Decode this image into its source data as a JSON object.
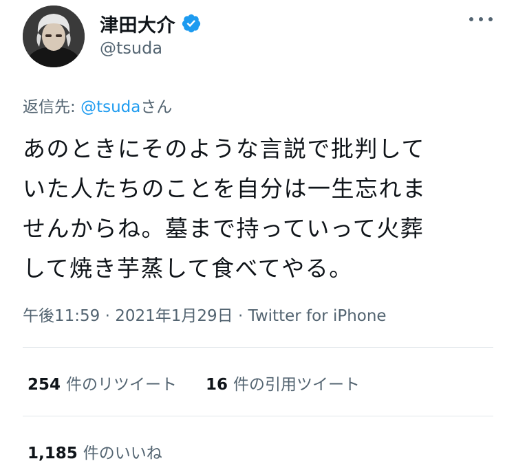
{
  "user": {
    "display_name": "津田大介",
    "handle": "@tsuda",
    "verified": true
  },
  "reply": {
    "prefix": "返信先: ",
    "mention": "@tsuda",
    "suffix": "さん"
  },
  "tweet": {
    "lines": [
      "あのときにそのような言説で批判して",
      "いた人たちのことを自分は一生忘れま",
      "せんからね。墓まで持っていって火葬",
      "して焼き芋蒸して食べてやる。"
    ]
  },
  "meta": {
    "time": "午後11:59",
    "sep1": " · ",
    "date": "2021年1月29日",
    "sep2": " · ",
    "source": "Twitter for iPhone"
  },
  "stats": {
    "retweets_count": "254",
    "retweets_label": "件のリツイート",
    "quotes_count": "16",
    "quotes_label": "件の引用ツイート",
    "likes_count": "1,185",
    "likes_label": "件のいいね"
  },
  "colors": {
    "accent": "#1d9bf0",
    "secondary_text": "#536471",
    "primary_text": "#0f1419"
  },
  "icons": {
    "verified": "verified-badge-icon",
    "more": "more-horizontal-icon"
  }
}
